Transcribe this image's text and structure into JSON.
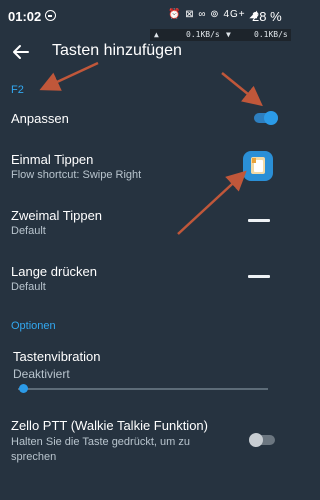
{
  "status_bar": {
    "time": "01:02",
    "icons": "⏰ ⊠ ∞ ⊚ 4G+ ◢",
    "battery": "28 %",
    "net_upload": "0.1KB/s",
    "net_download": "0.1KB/s"
  },
  "toolbar": {
    "title": "Tasten hinzufügen"
  },
  "section_f2": {
    "header": "F2",
    "customize": {
      "label": "Anpassen",
      "enabled": true
    },
    "single_tap": {
      "label": "Einmal Tippen",
      "value": "Flow shortcut: Swipe Right"
    },
    "double_tap": {
      "label": "Zweimal Tippen",
      "value": "Default"
    },
    "long_press": {
      "label": "Lange drücken",
      "value": "Default"
    }
  },
  "section_options": {
    "header": "Optionen",
    "vibration": {
      "label": "Tastenvibration",
      "value": "Deaktiviert",
      "level": 0
    },
    "zello": {
      "label": "Zello PTT (Walkie Talkie Funktion)",
      "description_line1": "Halten Sie die Taste gedrückt, um zu",
      "description_line2": "sprechen",
      "enabled": false
    }
  },
  "colors": {
    "background": "#263340",
    "accent": "#32a8f0",
    "annotation_arrow": "#c0573a"
  }
}
